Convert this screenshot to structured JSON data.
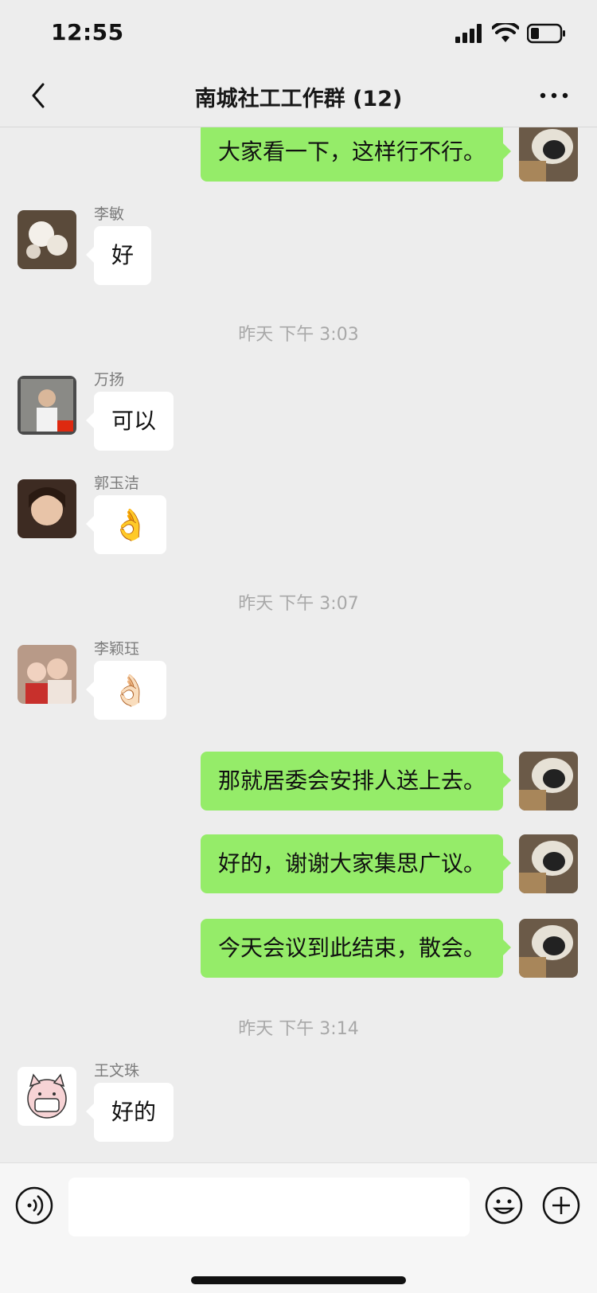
{
  "status_bar": {
    "time": "12:55"
  },
  "header": {
    "title": "南城社工工作群 (12)"
  },
  "messages": [
    {
      "text": "大家看一下，这样行不行。"
    },
    {
      "sender": "李敏",
      "text": "好"
    },
    {
      "timestamp": "昨天 下午 3:03"
    },
    {
      "sender": "万扬",
      "text": "可以"
    },
    {
      "sender": "郭玉洁",
      "text": "👌"
    },
    {
      "timestamp": "昨天 下午 3:07"
    },
    {
      "sender": "李颖珏",
      "text": "👌🏻"
    },
    {
      "text": "那就居委会安排人送上去。"
    },
    {
      "text": "好的，谢谢大家集思广议。"
    },
    {
      "text": "今天会议到此结束，散会。"
    },
    {
      "timestamp": "昨天 下午 3:14"
    },
    {
      "sender": "王文珠",
      "text": "好的"
    }
  ],
  "colors": {
    "self_bubble": "#95ec69",
    "other_bubble": "#ffffff",
    "background": "#ededed"
  },
  "icons": [
    "back-icon",
    "more-icon",
    "voice-icon",
    "emoji-icon",
    "plus-icon",
    "signal-icon",
    "wifi-icon",
    "battery-icon"
  ]
}
